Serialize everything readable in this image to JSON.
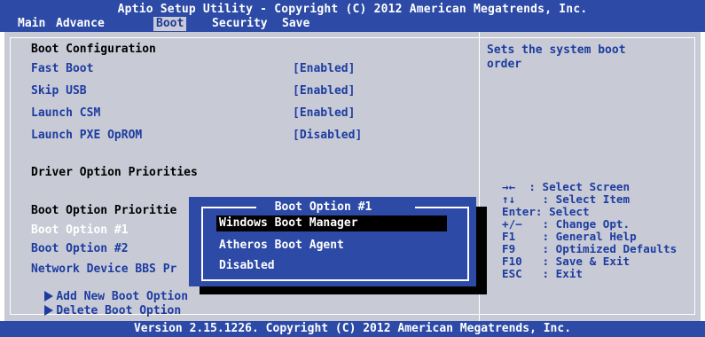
{
  "header": {
    "title": "Aptio Setup Utility - Copyright (C) 2012 American Megatrends, Inc.",
    "tabs": [
      "Main",
      "Advance",
      "Boot",
      "Security",
      "Save & Exit"
    ],
    "active_tab": "Boot"
  },
  "main": {
    "boot_configuration": "Boot Configuration",
    "settings": [
      {
        "label": "Fast Boot",
        "value": "[Enabled]"
      },
      {
        "label": "Skip USB",
        "value": "[Enabled]"
      },
      {
        "label": "Launch CSM",
        "value": "[Enabled]"
      },
      {
        "label": "Launch PXE OpROM",
        "value": "[Disabled]"
      }
    ],
    "driver_option_priorities": "Driver Option Priorities",
    "boot_option_priorities": "Boot Option Prioritie",
    "boot_options": [
      "Boot Option #1",
      "Boot Option #2"
    ],
    "network_device": "Network Device BBS Pr",
    "submenus": [
      "Add New Boot Option",
      "Delete Boot Option"
    ]
  },
  "help": {
    "description": [
      "Sets the system boot",
      "order"
    ],
    "keys": [
      {
        "key": "→←",
        "action": ": Select Screen"
      },
      {
        "key": "↑↓",
        "action": ": Select Item"
      },
      {
        "key": "Enter:",
        "action": "Select"
      },
      {
        "key": "+/−",
        "action": ": Change Opt."
      },
      {
        "key": "F1",
        "action": ": General Help"
      },
      {
        "key": "F9",
        "action": ": Optimized Defaults"
      },
      {
        "key": "F10",
        "action": ": Save & Exit"
      },
      {
        "key": "ESC",
        "action": ": Exit"
      }
    ]
  },
  "popup": {
    "title": "Boot Option #1",
    "items": [
      "Windows Boot Manager",
      "Atheros Boot Agent",
      "Disabled"
    ],
    "selected": "Windows Boot Manager"
  },
  "footer": {
    "version": "Version 2.15.1226. Copyright (C) 2012 American Megatrends, Inc."
  },
  "colors": {
    "bar_blue": "#2c4aa6",
    "panel_gray": "#c8cbd6",
    "text_blue": "#1e3ca0",
    "selection_black": "#000000"
  }
}
